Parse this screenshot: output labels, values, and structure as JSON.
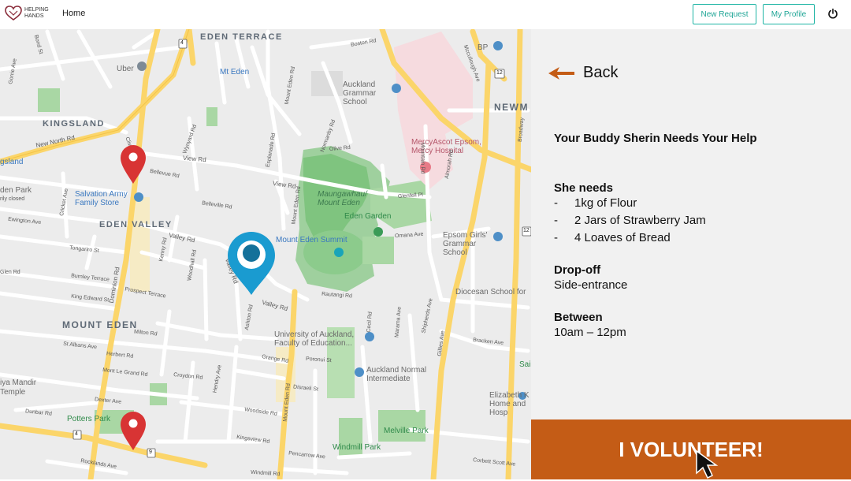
{
  "app": {
    "logo_text": "HELPING HANDS",
    "nav_home": "Home",
    "new_request": "New Request",
    "my_profile": "My Profile",
    "icons": [
      "heart-hands-logo",
      "power-icon"
    ]
  },
  "map": {
    "areas": [
      "EDEN TERRACE",
      "KINGSLAND",
      "EDEN VALLEY",
      "MOUNT EDEN",
      "NEWM"
    ],
    "pois": {
      "uber": "Uber",
      "mt_eden": "Mt Eden",
      "auckland_grammar": "Auckland Grammar School",
      "mercy": "MercyAscot Epsom, Mercy Hospital",
      "salvation": "Salvation Army Family Store",
      "maungawhau": "Maungawhau/ Mount Eden",
      "eden_garden": "Eden Garden",
      "summit": "Mount Eden Summit",
      "epsom_girls": "Epsom Girls' Grammar School",
      "diocesan": "Diocesan School for",
      "uni": "University of Auckland, Faculty of Education...",
      "normal": "Auckland Normal Intermediate",
      "elizabeth": "Elizabeth K Home and Hosp",
      "potters": "Potters Park",
      "melville": "Melville Park",
      "windmill": "Windmill Park",
      "gsland": "gsland",
      "eden_park": "den Park",
      "eden_park_sub": "rily closed",
      "mandir": "iya Mandir",
      "temple": "Temple",
      "bp": "BP",
      "sai": "Sai"
    },
    "streets": {
      "new_north": "New North Rd",
      "view_rd": "View Rd",
      "view_rd2": "View Rd",
      "valley_rd": "Valley Rd",
      "valley_rd2": "Valley Rd",
      "valley_rd3": "Valley Rd",
      "dominion": "Dominion Rd",
      "mount_eden_rd": "Mount Eden Rd",
      "mount_eden_rd2": "Mount Eden Rd",
      "mount_eden_rd3": "Mount Eden Rd",
      "esplanade": "Esplanade Rd",
      "normanby": "Normanby Rd",
      "boston": "Boston Rd",
      "gillies": "Gillies Ave",
      "mountain": "Mountain Rd",
      "bond": "Bond St",
      "prospect": "Prospect Terrace",
      "king_edward": "King Edward St",
      "burnley": "Burnley Terrace",
      "tongariro": "Tongariro St",
      "herbert": "Herbert Rd",
      "st_albans": "St Albans Ave",
      "milton": "Milton Rd",
      "mont_le_grand": "Mont Le Grand Rd",
      "croydon": "Croydon Rd",
      "dexter": "Dexter Ave",
      "dunbar": "Dunbar Rd",
      "rocklands": "Rocklands Ave",
      "woodside": "Woodside Rd",
      "kingsview": "Kingsview Rd",
      "pencarrow": "Pencarrow Ave",
      "disraeli": "Disraeli St",
      "grange": "Grange Rd",
      "poronui": "Poronui St",
      "rautangi": "Rautangi Rd",
      "omana": "Omana Ave",
      "glenfell": "Glenfell Pl",
      "olive": "Olive Rd",
      "almorah": "Almorah Rd",
      "bracken": "Bracken Ave",
      "corbett": "Corbett Scott Ave",
      "cecil": "Cecil Rd",
      "marama": "Marama Ave",
      "shipherds": "Shipherds Ave",
      "belleville": "Belleville Rd",
      "bellevue": "Bellevue Rd",
      "ashton": "Ashton Rd",
      "hendry": "Hendry Ave",
      "ewington": "Ewington Ave",
      "gorrie": "Gorrie Ave",
      "kenny": "Kenny Rd",
      "woodhall": "Woodhall Rd",
      "windmill_rd": "Windmill Rd",
      "wynyard": "Wynyard Rd",
      "clive": "Clive Rd",
      "mccullough": "Mccullough Ave",
      "broadway": "Broadway",
      "cricket": "Cricket Ave",
      "glen": "Glen Rd"
    },
    "route_badges": [
      "4",
      "12",
      "12",
      "4",
      "9"
    ]
  },
  "panel": {
    "back_label": "Back",
    "heading": "Your Buddy Sherin Needs Your Help",
    "needs_title": "She needs",
    "needs": [
      {
        "dash": "-",
        "text": "1kg of Flour"
      },
      {
        "dash": "-",
        "text": "2 Jars of Strawberry Jam"
      },
      {
        "dash": "-",
        "text": "4 Loaves of Bread"
      }
    ],
    "dropoff_title": "Drop-off",
    "dropoff": "Side-entrance",
    "between_title": "Between",
    "between": "10am – 12pm",
    "volunteer_label": "I VOLUNTEER!"
  },
  "colors": {
    "accent_teal": "#1fb5a5",
    "volunteer_orange": "#c45c16",
    "back_arrow": "#c45c16",
    "marker_blue": "#1a9bd0",
    "marker_red": "#d83434"
  }
}
